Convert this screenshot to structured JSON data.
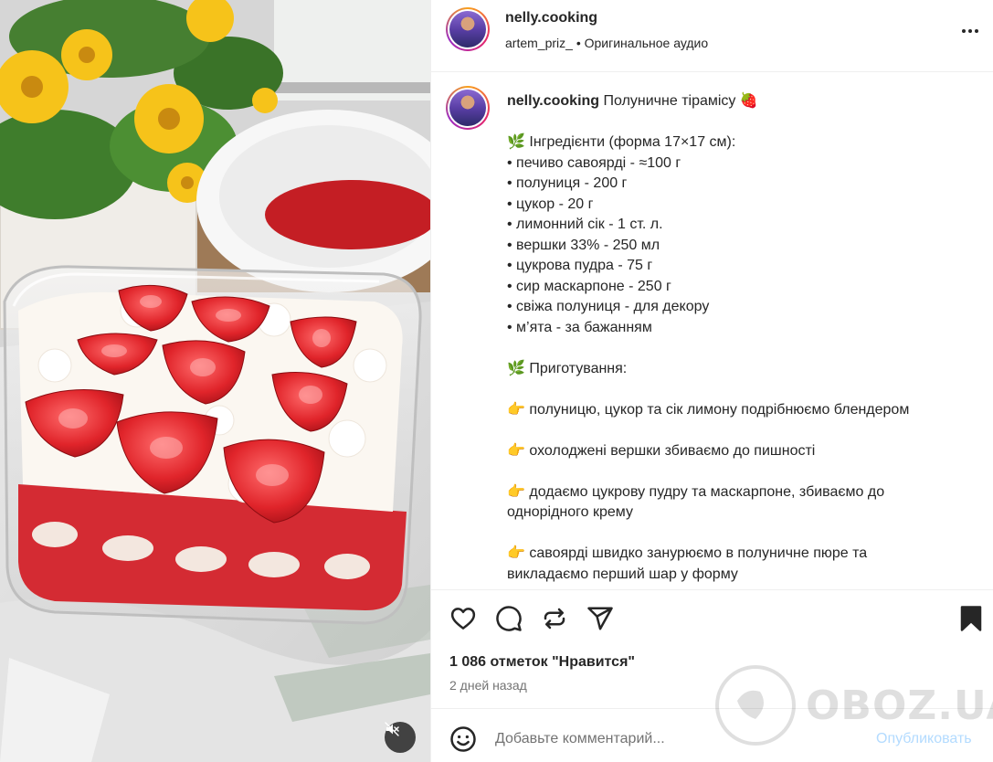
{
  "post": {
    "username": "nelly.cooking",
    "audio_author": "artem_priz_",
    "audio_sep": "•",
    "audio_label": "Оригинальное аудио"
  },
  "caption": {
    "username": "nelly.cooking",
    "title": "Полуничне тірамісу",
    "title_emoji": "🍓",
    "lines": [
      "🌿  Інгредієнти (форма 17×17 см):",
      "• печиво савоярді - ≈100 г",
      "• полуниця - 200 г",
      "• цукор - 20 г",
      "• лимонний сік - 1 ст. л.",
      "• вершки 33% - 250 мл",
      "• цукрова пудра - 75 г",
      "• сир маскарпоне - 250 г",
      "• свіжа полуниця - для декору",
      "• м’ята - за бажанням",
      "",
      "🌿  Приготування:",
      "",
      "👉  полуницю, цукор та сік лимону подрібнюємо блендером",
      "",
      "👉  охолоджені вершки збиваємо до пишності",
      "",
      "👉  додаємо цукрову пудру та маскарпоне, збиваємо до",
      "однорідного крему",
      "",
      "👉  савоярді швидко занурюємо в полуничне пюре та",
      "викладаємо перший шар у форму"
    ]
  },
  "stats": {
    "likes": "1 086 отметок \"Нравится\"",
    "date": "2 дней назад"
  },
  "comment": {
    "placeholder": "Добавьте комментарий...",
    "publish_label": "Опубликовать"
  },
  "watermark": {
    "text": "OBOZ.UA"
  },
  "icons": {
    "like": "heart-icon",
    "comment": "comment-icon",
    "repost": "repost-icon",
    "share": "send-icon",
    "save": "bookmark-icon",
    "emoji": "emoji-icon",
    "mute": "speaker-muted-icon",
    "more": "more-dots-icon"
  },
  "colors": {
    "text": "#262626",
    "secondary": "#737373",
    "publish_disabled": "#b3dbff",
    "divider": "#efefef"
  }
}
